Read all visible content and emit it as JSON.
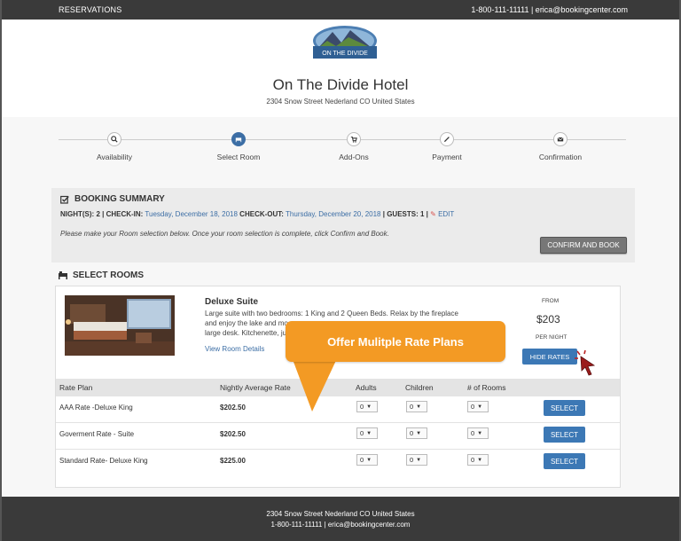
{
  "topbar": {
    "brand": "RESERVATIONS",
    "contact": "1-800-111-11111 | erica@bookingcenter.com"
  },
  "header": {
    "logo_text": "ON THE DIVIDE",
    "hotel_name": "On The Divide Hotel",
    "address": "2304 Snow Street Nederland CO United States"
  },
  "steps": [
    {
      "label": "Availability",
      "icon": "search-icon",
      "active": false
    },
    {
      "label": "Select Room",
      "icon": "bed-icon",
      "active": true
    },
    {
      "label": "Add-Ons",
      "icon": "cart-icon",
      "active": false
    },
    {
      "label": "Payment",
      "icon": "pencil-icon",
      "active": false
    },
    {
      "label": "Confirmation",
      "icon": "envelope-icon",
      "active": false
    }
  ],
  "summary": {
    "title": "BOOKING SUMMARY",
    "nights_label": "NIGHT(S): 2 | CHECK-IN:",
    "checkin": "Tuesday, December 18, 2018",
    "checkout_label": "CHECK-OUT:",
    "checkout": "Thursday, December 20, 2018",
    "guests_label": "| GUESTS: 1 |",
    "edit": "EDIT",
    "note": "Please make your Room selection below. Once your room selection is complete, click Confirm and Book.",
    "confirm_button": "CONFIRM AND BOOK"
  },
  "select_rooms": {
    "title": "SELECT ROOMS",
    "room": {
      "name": "Deluxe Suite",
      "desc_line1": "Large suite with two bedrooms: 1 King and 2 Queen Beds. Relax by the fireplace",
      "desc_line2": "and enjoy the lake and mo",
      "desc_line3": "large desk. Kitchenette, ju",
      "link": "View Room Details",
      "from_label": "FROM",
      "price": "$203",
      "per_night": "PER NIGHT",
      "hide_rates_button": "HIDE RATES"
    },
    "columns": [
      "Rate Plan",
      "Nightly Average Rate",
      "Adults",
      "Children",
      "# of Rooms"
    ],
    "rates": [
      {
        "plan": "AAA Rate -Deluxe King",
        "rate": "$202.50",
        "adults": "0",
        "children": "0",
        "rooms": "0",
        "button": "SELECT"
      },
      {
        "plan": "Goverment Rate - Suite",
        "rate": "$202.50",
        "adults": "0",
        "children": "0",
        "rooms": "0",
        "button": "SELECT"
      },
      {
        "plan": "Standard Rate- Deluxe King",
        "rate": "$225.00",
        "adults": "0",
        "children": "0",
        "rooms": "0",
        "button": "SELECT"
      }
    ]
  },
  "callout": "Offer Mulitple Rate Plans",
  "footer": {
    "address": "2304 Snow Street Nederland CO United States",
    "contact": "1-800-111-11111 | erica@bookingcenter.com"
  },
  "colors": {
    "accent_blue": "#3c78b5",
    "callout_orange": "#f39a24",
    "dark_bar": "#3a3a3a"
  }
}
